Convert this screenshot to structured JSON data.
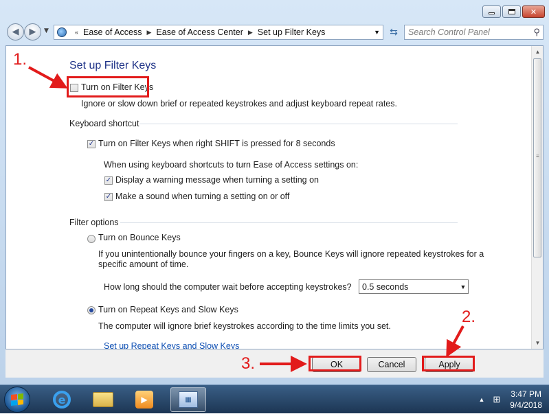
{
  "window": {
    "minimize_icon": "minimize-icon",
    "maximize_icon": "maximize-icon",
    "close_glyph": "✕"
  },
  "nav": {
    "address": [
      "Ease of Access",
      "Ease of Access Center",
      "Set up Filter Keys"
    ],
    "search_placeholder": "Search Control Panel"
  },
  "page": {
    "title": "Set up Filter Keys",
    "turn_on_filter_keys": "Turn on Filter Keys",
    "filter_keys_desc": "Ignore or slow down brief or repeated keystrokes and adjust keyboard repeat rates.",
    "keyboard_shortcut_heading": "Keyboard shortcut",
    "shortcut_checkbox": "Turn on Filter Keys when right SHIFT is pressed for 8 seconds",
    "shortcut_settings_label": "When using keyboard shortcuts to turn Ease of Access settings on:",
    "warning_checkbox": "Display a warning message when turning a setting on",
    "sound_checkbox": "Make a sound when turning a setting on or off",
    "filter_options_heading": "Filter options",
    "bounce_keys_radio": "Turn on Bounce Keys",
    "bounce_desc_line1": "If you unintentionally bounce your fingers on a key, Bounce Keys will ignore repeated keystrokes for a",
    "bounce_desc_line2": "specific amount of time.",
    "wait_label": "How long should the computer wait before accepting keystrokes?",
    "wait_value": "0.5 seconds",
    "repeat_keys_radio": "Turn on Repeat Keys and Slow Keys",
    "repeat_desc": "The computer will ignore brief keystrokes according to the time limits you set.",
    "repeat_link": "Set up Repeat Keys and Slow Keys"
  },
  "buttons": {
    "ok": "OK",
    "cancel": "Cancel",
    "apply": "Apply"
  },
  "annotations": {
    "step1": "1.",
    "step2": "2.",
    "step3": "3.",
    "color": "#e21b1b"
  },
  "taskbar": {
    "time": "3:47 PM",
    "date": "9/4/2018"
  }
}
